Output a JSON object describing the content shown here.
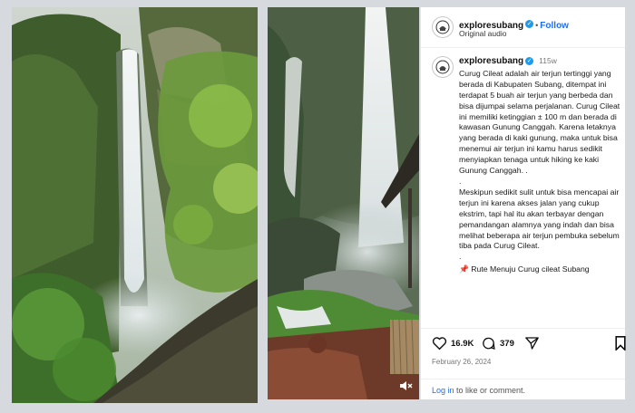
{
  "post": {
    "username": "exploresubang",
    "follow_label": "Follow",
    "audio": "Original audio",
    "time_ago": "115w",
    "caption_paragraphs": [
      "Curug Cileat adalah air terjun tertinggi yang berada di Kabupaten Subang, ditempat ini terdapat 5 buah air terjun yang berbeda dan bisa dijumpai selama perjalanan. Curug Cileat ini memiliki ketinggian ± 100 m dan berada di kawasan Gunung Canggah. Karena letaknya yang berada di kaki gunung, maka untuk bisa menemui air terjun ini kamu harus sedikit menyiapkan tenaga untuk hiking ke kaki Gunung Canggah. .",
      ".",
      "Meskipun sedikit sulit untuk bisa mencapai air terjun ini karena akses jalan yang cukup ekstrim, tapi hal itu akan terbayar dengan pemandangan alamnya yang indah dan bisa melihat beberapa air terjun pembuka sebelum tiba pada Curug Cileat.",
      "."
    ],
    "route_line": "Rute Menuju Curug cileat Subang",
    "likes": "16.9K",
    "comments": "379",
    "date": "February 26, 2024",
    "login_link": "Log in",
    "login_text": " to like or comment."
  },
  "icons": {
    "verified": "verified-badge-icon",
    "pin": "pushpin-icon",
    "like": "heart-icon",
    "comment": "comment-bubble-icon",
    "share": "send-icon",
    "save": "bookmark-icon",
    "mute": "speaker-muted-icon"
  },
  "colors": {
    "link": "#1d6ff2",
    "verified": "#1d9bf0"
  }
}
